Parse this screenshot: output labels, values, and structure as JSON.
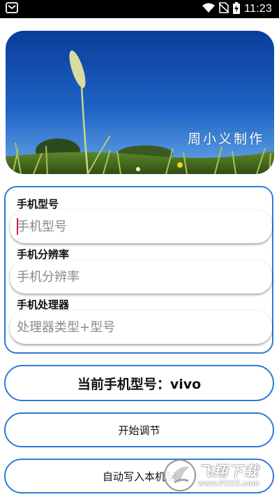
{
  "status_bar": {
    "time": "11:23",
    "icons": [
      "notification-icon",
      "wifi-icon",
      "no-sim-icon",
      "battery-charging-icon"
    ]
  },
  "banner": {
    "caption": "周小义制作"
  },
  "form": {
    "model_label": "手机型号",
    "model_placeholder": "手机型号",
    "resolution_label": "手机分辨率",
    "resolution_placeholder": "手机分辨率",
    "processor_label": "手机处理器",
    "processor_placeholder": "处理器类型+型号"
  },
  "current_model": {
    "text": "当前手机型号：vivo"
  },
  "actions": {
    "start_label": "开始调节",
    "write_label": "自动写入本机配"
  },
  "watermark": {
    "name": "飞翔下载",
    "url": "www.FXXZ.com"
  },
  "colors": {
    "accent": "#2e7bd6",
    "status_bar": "#000000",
    "caret": "#d81b60"
  }
}
